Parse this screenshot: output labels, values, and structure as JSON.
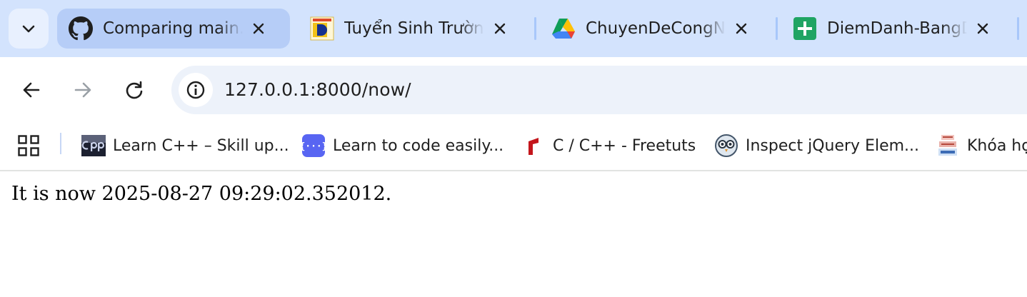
{
  "browser": {
    "tabs": [
      {
        "title": "Comparing main...v",
        "favicon": "github-icon",
        "active": true
      },
      {
        "title": "Tuyển Sinh Trường",
        "favicon": "school-logo-icon",
        "active": false
      },
      {
        "title": "ChuyenDeCongNghe",
        "favicon": "google-drive-icon",
        "active": false
      },
      {
        "title": "DiemDanh-BangDiem",
        "favicon": "google-sheets-icon",
        "active": false
      }
    ],
    "close_icon": "close-icon",
    "toolbar": {
      "back_icon": "back-arrow-icon",
      "forward_icon": "forward-arrow-icon",
      "reload_icon": "reload-icon",
      "site_info_icon": "info-icon",
      "url": "127.0.0.1:8000/now/"
    },
    "bookmarks": [
      {
        "label": "Learn C++ – Skill up...",
        "icon": "cpp-icon"
      },
      {
        "label": "Learn to code easily...",
        "icon": "code-icon"
      },
      {
        "label": "C / C++ - Freetuts",
        "icon": "freetuts-icon"
      },
      {
        "label": "Inspect jQuery Elem...",
        "icon": "owl-icon"
      },
      {
        "label": "Khóa họ",
        "icon": "day-nhau-hoc-icon"
      }
    ],
    "colors": {
      "tabstrip_bg": "#d3e3fd",
      "active_tab_bg": "#b6cdf7",
      "omnibox_bg": "#edf2fa"
    }
  },
  "page": {
    "text": "It is now 2025-08-27 09:29:02.352012."
  }
}
